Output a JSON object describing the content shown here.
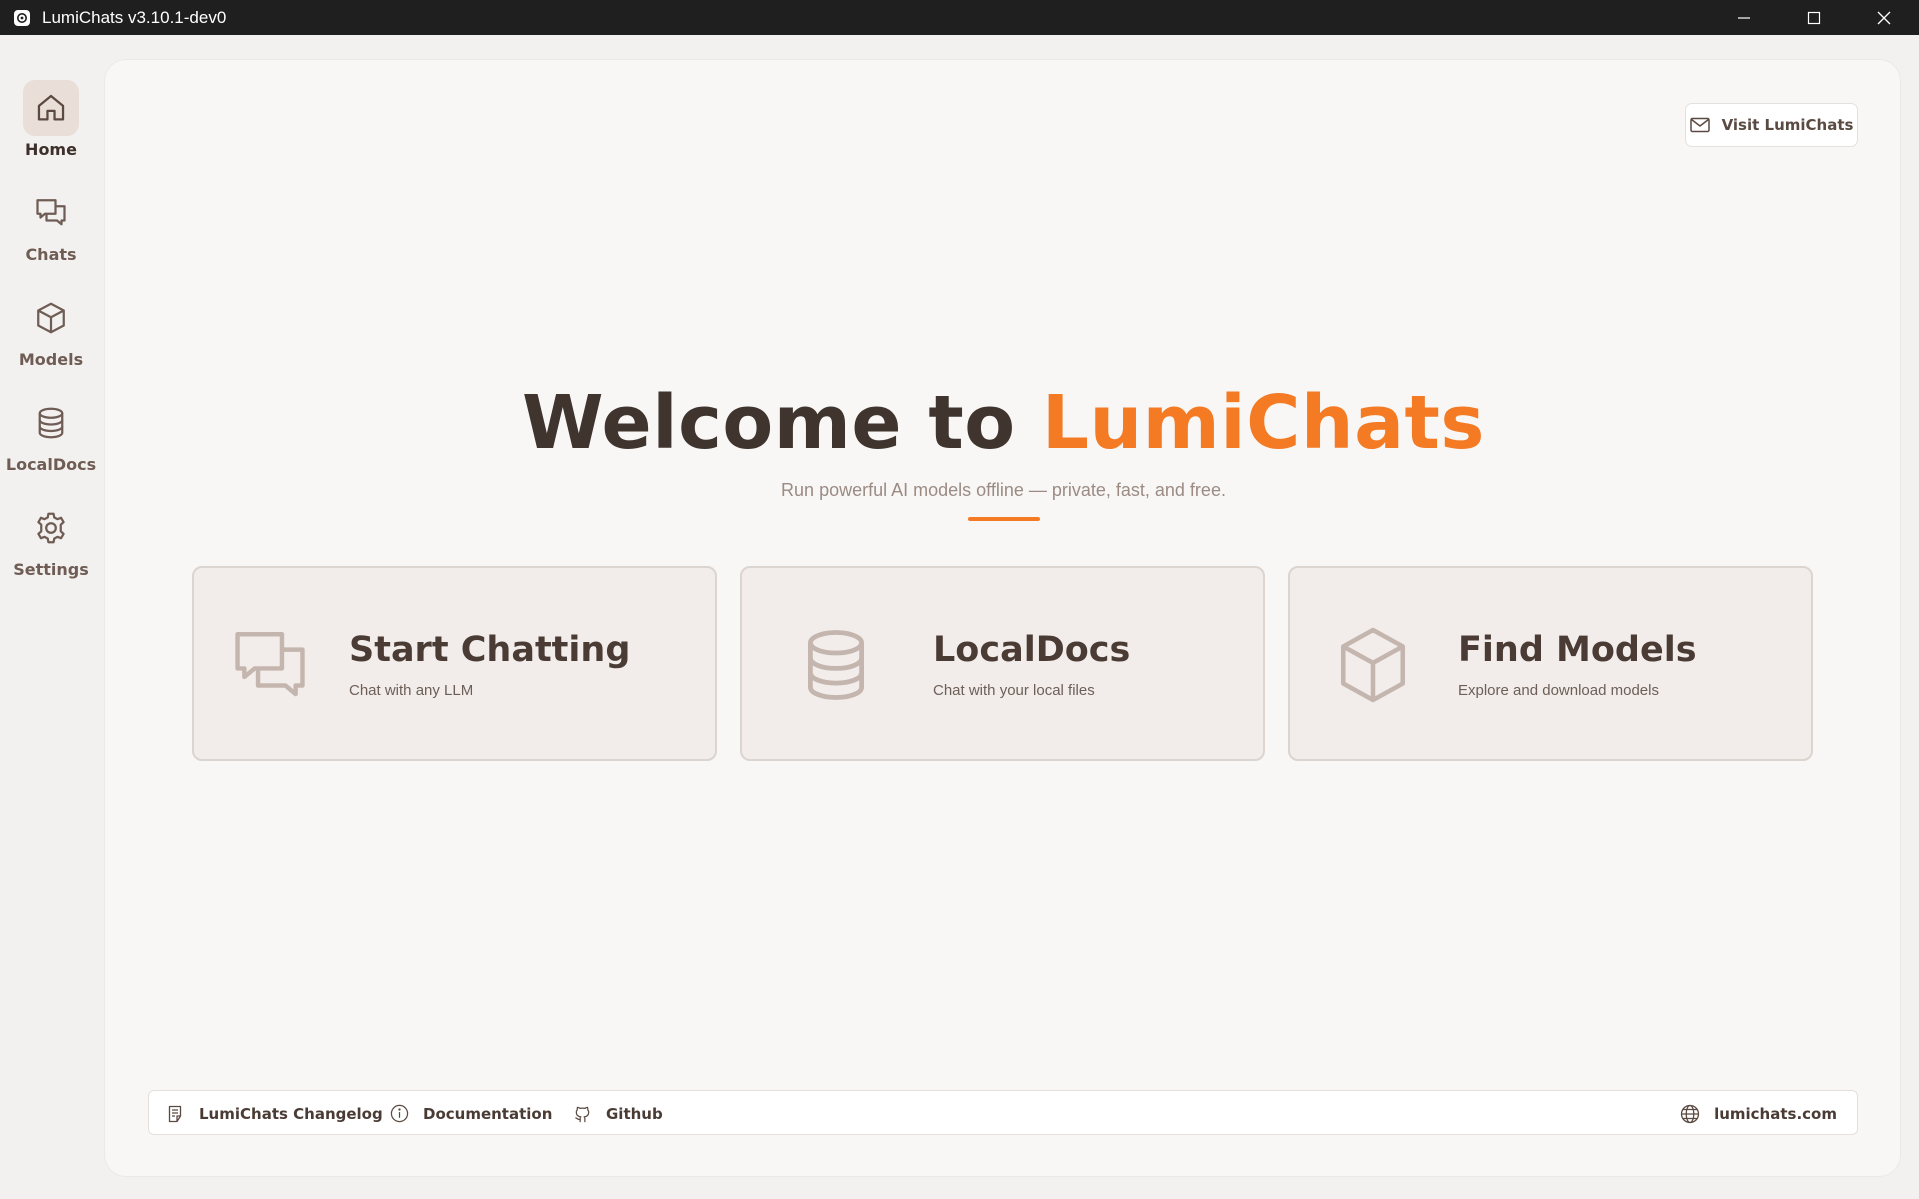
{
  "window": {
    "title": "LumiChats v3.10.1-dev0",
    "controls": [
      "minimize-icon",
      "maximize-icon",
      "close-icon"
    ]
  },
  "sidebar": {
    "items": [
      {
        "label": "Home",
        "icon": "home-icon",
        "active": true
      },
      {
        "label": "Chats",
        "icon": "chat-bubbles-icon",
        "active": false
      },
      {
        "label": "Models",
        "icon": "cube-icon",
        "active": false
      },
      {
        "label": "LocalDocs",
        "icon": "database-icon",
        "active": false
      },
      {
        "label": "Settings",
        "icon": "gear-icon",
        "active": false
      }
    ]
  },
  "header": {
    "visit_label": "Visit LumiChats",
    "visit_icon": "mail-icon"
  },
  "hero": {
    "welcome_prefix": "Welcome to ",
    "brand": "LumiChats",
    "tagline": "Run powerful AI models offline — private, fast, and free."
  },
  "cards": [
    {
      "title": "Start Chatting",
      "subtitle": "Chat with any LLM",
      "icon": "chat-bubbles-icon"
    },
    {
      "title": "LocalDocs",
      "subtitle": "Chat with your local files",
      "icon": "database-icon"
    },
    {
      "title": "Find Models",
      "subtitle": "Explore and download models",
      "icon": "cube-icon"
    }
  ],
  "footer": {
    "links": [
      {
        "label": "LumiChats Changelog",
        "icon": "changelog-icon"
      },
      {
        "label": "Documentation",
        "icon": "info-icon"
      },
      {
        "label": "Github",
        "icon": "github-icon"
      }
    ],
    "website": {
      "label": "lumichats.com",
      "icon": "globe-icon"
    }
  },
  "colors": {
    "accent": "#f47a23",
    "text_dark": "#3f342e",
    "nav_active_bg": "#eadfd8",
    "card_bg": "#f2edea"
  }
}
